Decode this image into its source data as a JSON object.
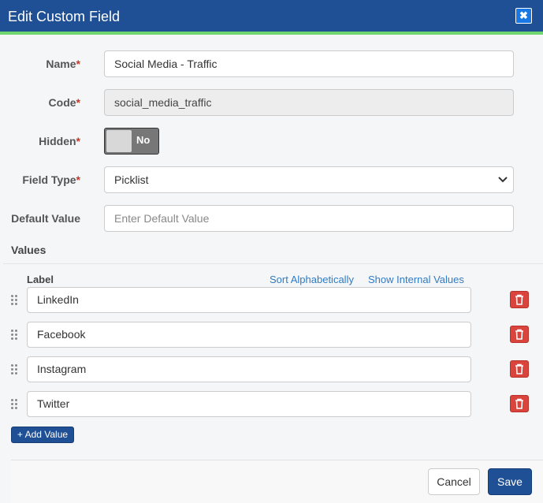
{
  "dialog": {
    "title": "Edit Custom Field",
    "close_glyph": "✖"
  },
  "form": {
    "name": {
      "label": "Name",
      "required": "*",
      "value": "Social Media - Traffic"
    },
    "code": {
      "label": "Code",
      "required": "*",
      "value": "social_media_traffic"
    },
    "hidden": {
      "label": "Hidden",
      "required": "*",
      "toggle_text": "No",
      "on": false
    },
    "field_type": {
      "label": "Field Type",
      "required": "*",
      "value": "Picklist"
    },
    "default_value": {
      "label": "Default Value",
      "placeholder": "Enter Default Value"
    }
  },
  "values": {
    "title": "Values",
    "column_label": "Label",
    "sort_link": "Sort Alphabetically",
    "internal_link": "Show Internal Values",
    "items": [
      {
        "label": "LinkedIn"
      },
      {
        "label": "Facebook"
      },
      {
        "label": "Instagram"
      },
      {
        "label": "Twitter"
      }
    ],
    "add_label": "+ Add Value"
  },
  "footer": {
    "cancel_label": "Cancel",
    "save_label": "Save"
  },
  "colors": {
    "header": "#1f4f94",
    "accent": "#6fd66f",
    "danger": "#d9443c",
    "link": "#2f7bc4"
  },
  "icons": {
    "close": "close-icon",
    "drag": "drag-handle-icon",
    "delete": "trash-icon",
    "dropdown": "chevron-down-icon"
  }
}
